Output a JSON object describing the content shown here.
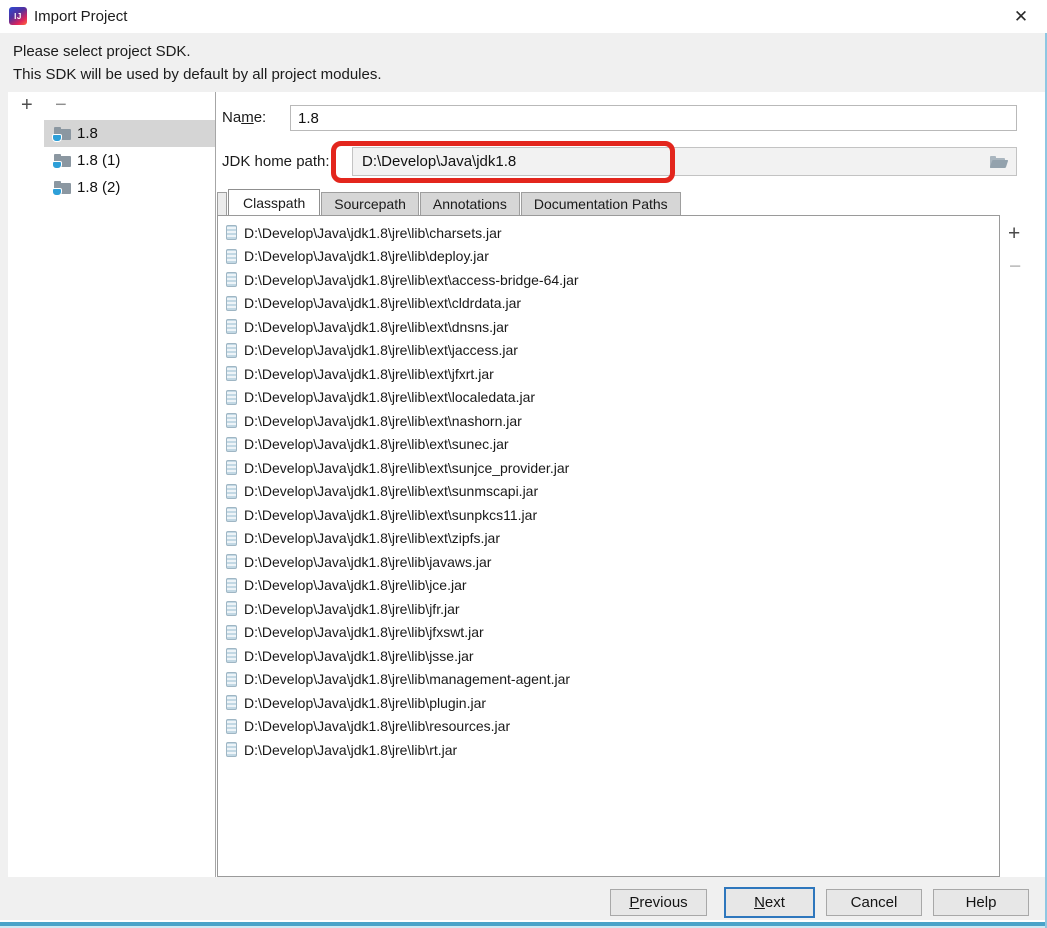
{
  "window": {
    "title": "Import Project",
    "close_glyph": "✕",
    "logo_text": "IJ"
  },
  "header": {
    "line1": "Please select project SDK.",
    "line2": "This SDK will be used by default by all project modules."
  },
  "sidebar": {
    "add_label": "+",
    "remove_label": "−",
    "items": [
      {
        "label": "1.8",
        "selected": true
      },
      {
        "label": "1.8 (1)",
        "selected": false
      },
      {
        "label": "1.8 (2)",
        "selected": false
      }
    ]
  },
  "form": {
    "name_label": {
      "pre": "Na",
      "mn": "m",
      "post": "e:"
    },
    "name_value": "1.8",
    "jdk_label": "JDK home path:",
    "jdk_value": "D:\\Develop\\Java\\jdk1.8"
  },
  "tabs": [
    {
      "label": "Classpath",
      "active": true
    },
    {
      "label": "Sourcepath",
      "active": false
    },
    {
      "label": "Annotations",
      "active": false
    },
    {
      "label": "Documentation Paths",
      "active": false
    }
  ],
  "classpath": {
    "add_label": "+",
    "remove_label": "−",
    "entries": [
      "D:\\Develop\\Java\\jdk1.8\\jre\\lib\\charsets.jar",
      "D:\\Develop\\Java\\jdk1.8\\jre\\lib\\deploy.jar",
      "D:\\Develop\\Java\\jdk1.8\\jre\\lib\\ext\\access-bridge-64.jar",
      "D:\\Develop\\Java\\jdk1.8\\jre\\lib\\ext\\cldrdata.jar",
      "D:\\Develop\\Java\\jdk1.8\\jre\\lib\\ext\\dnsns.jar",
      "D:\\Develop\\Java\\jdk1.8\\jre\\lib\\ext\\jaccess.jar",
      "D:\\Develop\\Java\\jdk1.8\\jre\\lib\\ext\\jfxrt.jar",
      "D:\\Develop\\Java\\jdk1.8\\jre\\lib\\ext\\localedata.jar",
      "D:\\Develop\\Java\\jdk1.8\\jre\\lib\\ext\\nashorn.jar",
      "D:\\Develop\\Java\\jdk1.8\\jre\\lib\\ext\\sunec.jar",
      "D:\\Develop\\Java\\jdk1.8\\jre\\lib\\ext\\sunjce_provider.jar",
      "D:\\Develop\\Java\\jdk1.8\\jre\\lib\\ext\\sunmscapi.jar",
      "D:\\Develop\\Java\\jdk1.8\\jre\\lib\\ext\\sunpkcs11.jar",
      "D:\\Develop\\Java\\jdk1.8\\jre\\lib\\ext\\zipfs.jar",
      "D:\\Develop\\Java\\jdk1.8\\jre\\lib\\javaws.jar",
      "D:\\Develop\\Java\\jdk1.8\\jre\\lib\\jce.jar",
      "D:\\Develop\\Java\\jdk1.8\\jre\\lib\\jfr.jar",
      "D:\\Develop\\Java\\jdk1.8\\jre\\lib\\jfxswt.jar",
      "D:\\Develop\\Java\\jdk1.8\\jre\\lib\\jsse.jar",
      "D:\\Develop\\Java\\jdk1.8\\jre\\lib\\management-agent.jar",
      "D:\\Develop\\Java\\jdk1.8\\jre\\lib\\plugin.jar",
      "D:\\Develop\\Java\\jdk1.8\\jre\\lib\\resources.jar",
      "D:\\Develop\\Java\\jdk1.8\\jre\\lib\\rt.jar"
    ]
  },
  "footer": {
    "previous": {
      "mn": "P",
      "post": "revious"
    },
    "next": {
      "mn": "N",
      "post": "ext"
    },
    "cancel_label": "Cancel",
    "help_label": "Help"
  },
  "colors": {
    "annotation_red": "#e3261d",
    "focus_blue": "#2e77bd",
    "bottom_edge_cyan": "#4aa3c9",
    "selection_gray": "#d5d5d5"
  }
}
